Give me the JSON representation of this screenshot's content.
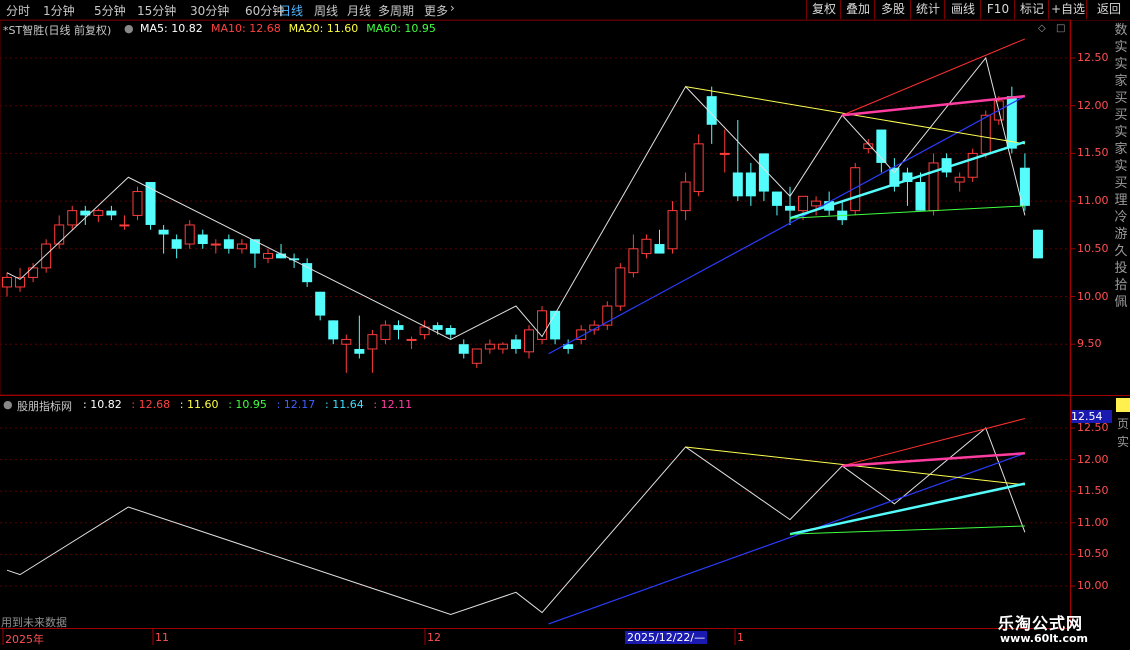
{
  "periods": [
    "分时",
    "1分钟",
    "5分钟",
    "15分钟",
    "30分钟",
    "60分钟",
    "日线",
    "周线",
    "月线",
    "多周期",
    "更多"
  ],
  "active_period": "日线",
  "right_buttons": [
    "复权",
    "叠加",
    "多股",
    "统计",
    "画线",
    "F10",
    "标记",
    "+自选",
    "返回"
  ],
  "main": {
    "title": "*ST智胜(日线 前复权)",
    "ma": [
      {
        "label": "MA5: 10.82",
        "color": "#ffffff"
      },
      {
        "label": "MA10: 12.68",
        "color": "#ff4040"
      },
      {
        "label": "MA20: 11.60",
        "color": "#ffff40"
      },
      {
        "label": "MA60: 10.95",
        "color": "#40ff40"
      }
    ],
    "yticks": [
      "12.50",
      "12.00",
      "11.50",
      "11.00",
      "10.50",
      "10.00",
      "9.50"
    ]
  },
  "sub": {
    "title": "股朋指标网",
    "values": [
      {
        "label": ": 10.82",
        "color": "#ffffff"
      },
      {
        "label": ": 12.68",
        "color": "#ff4040"
      },
      {
        "label": ": 11.60",
        "color": "#ffff40"
      },
      {
        "label": ": 10.95",
        "color": "#40ff40"
      },
      {
        "label": ": 12.17",
        "color": "#4060ff"
      },
      {
        "label": ": 11.64",
        "color": "#40e0ff"
      },
      {
        "label": ": 12.11",
        "color": "#ff40a0"
      }
    ],
    "yticks": [
      "12.50",
      "12.00",
      "11.50",
      "11.00",
      "10.50",
      "10.00"
    ],
    "current_value": "12.54",
    "future_note": "用到未来数据"
  },
  "time_axis": {
    "labels": [
      "2025年",
      "11",
      "12",
      "1"
    ],
    "cursor_date": "2025/12/22/—"
  },
  "side_text": [
    "数",
    "实",
    "实",
    "家",
    "买",
    "买",
    "实",
    "家",
    "实",
    "买",
    "理",
    "冷",
    "游",
    "久",
    "投",
    "拾",
    "佩"
  ],
  "sub_side_text": [
    "页",
    "实"
  ],
  "watermark": {
    "name": "乐淘公式网",
    "url": "www.60lt.com"
  },
  "chart_data": {
    "type": "candlestick",
    "price_range": [
      9.0,
      12.9
    ],
    "candles": [
      {
        "o": 10.1,
        "h": 10.25,
        "l": 10.0,
        "c": 10.2
      },
      {
        "o": 10.1,
        "h": 10.3,
        "l": 10.05,
        "c": 10.2
      },
      {
        "o": 10.2,
        "h": 10.35,
        "l": 10.15,
        "c": 10.3
      },
      {
        "o": 10.3,
        "h": 10.6,
        "l": 10.25,
        "c": 10.55
      },
      {
        "o": 10.55,
        "h": 10.85,
        "l": 10.5,
        "c": 10.75
      },
      {
        "o": 10.75,
        "h": 10.95,
        "l": 10.7,
        "c": 10.9
      },
      {
        "o": 10.9,
        "h": 10.95,
        "l": 10.75,
        "c": 10.85
      },
      {
        "o": 10.85,
        "h": 10.92,
        "l": 10.78,
        "c": 10.9
      },
      {
        "o": 10.9,
        "h": 10.95,
        "l": 10.8,
        "c": 10.85
      },
      {
        "o": 10.75,
        "h": 10.85,
        "l": 10.7,
        "c": 10.75
      },
      {
        "o": 10.85,
        "h": 11.15,
        "l": 10.8,
        "c": 11.1
      },
      {
        "o": 11.2,
        "h": 11.2,
        "l": 10.7,
        "c": 10.75
      },
      {
        "o": 10.7,
        "h": 10.75,
        "l": 10.45,
        "c": 10.65
      },
      {
        "o": 10.6,
        "h": 10.65,
        "l": 10.4,
        "c": 10.5
      },
      {
        "o": 10.55,
        "h": 10.8,
        "l": 10.5,
        "c": 10.75
      },
      {
        "o": 10.65,
        "h": 10.7,
        "l": 10.5,
        "c": 10.55
      },
      {
        "o": 10.55,
        "h": 10.6,
        "l": 10.45,
        "c": 10.55
      },
      {
        "o": 10.6,
        "h": 10.65,
        "l": 10.45,
        "c": 10.5
      },
      {
        "o": 10.5,
        "h": 10.6,
        "l": 10.45,
        "c": 10.55
      },
      {
        "o": 10.6,
        "h": 10.6,
        "l": 10.3,
        "c": 10.45
      },
      {
        "o": 10.4,
        "h": 10.5,
        "l": 10.35,
        "c": 10.45
      },
      {
        "o": 10.45,
        "h": 10.55,
        "l": 10.4,
        "c": 10.4
      },
      {
        "o": 10.4,
        "h": 10.45,
        "l": 10.3,
        "c": 10.38
      },
      {
        "o": 10.35,
        "h": 10.4,
        "l": 10.1,
        "c": 10.15
      },
      {
        "o": 10.05,
        "h": 10.05,
        "l": 9.75,
        "c": 9.8
      },
      {
        "o": 9.75,
        "h": 9.75,
        "l": 9.5,
        "c": 9.55
      },
      {
        "o": 9.5,
        "h": 9.6,
        "l": 9.2,
        "c": 9.55
      },
      {
        "o": 9.45,
        "h": 9.8,
        "l": 9.35,
        "c": 9.4
      },
      {
        "o": 9.45,
        "h": 9.65,
        "l": 9.2,
        "c": 9.6
      },
      {
        "o": 9.55,
        "h": 9.75,
        "l": 9.5,
        "c": 9.7
      },
      {
        "o": 9.7,
        "h": 9.75,
        "l": 9.55,
        "c": 9.65
      },
      {
        "o": 9.55,
        "h": 9.58,
        "l": 9.45,
        "c": 9.55
      },
      {
        "o": 9.6,
        "h": 9.75,
        "l": 9.55,
        "c": 9.68
      },
      {
        "o": 9.7,
        "h": 9.73,
        "l": 9.6,
        "c": 9.65
      },
      {
        "o": 9.67,
        "h": 9.7,
        "l": 9.55,
        "c": 9.6
      },
      {
        "o": 9.5,
        "h": 9.55,
        "l": 9.35,
        "c": 9.4
      },
      {
        "o": 9.3,
        "h": 9.45,
        "l": 9.25,
        "c": 9.45
      },
      {
        "o": 9.45,
        "h": 9.55,
        "l": 9.4,
        "c": 9.5
      },
      {
        "o": 9.45,
        "h": 9.52,
        "l": 9.4,
        "c": 9.5
      },
      {
        "o": 9.55,
        "h": 9.6,
        "l": 9.4,
        "c": 9.45
      },
      {
        "o": 9.42,
        "h": 9.7,
        "l": 9.35,
        "c": 9.65
      },
      {
        "o": 9.55,
        "h": 9.9,
        "l": 9.5,
        "c": 9.85
      },
      {
        "o": 9.85,
        "h": 9.85,
        "l": 9.5,
        "c": 9.55
      },
      {
        "o": 9.5,
        "h": 9.55,
        "l": 9.4,
        "c": 9.45
      },
      {
        "o": 9.55,
        "h": 9.7,
        "l": 9.5,
        "c": 9.65
      },
      {
        "o": 9.65,
        "h": 9.75,
        "l": 9.6,
        "c": 9.7
      },
      {
        "o": 9.7,
        "h": 9.95,
        "l": 9.65,
        "c": 9.9
      },
      {
        "o": 9.9,
        "h": 10.35,
        "l": 9.85,
        "c": 10.3
      },
      {
        "o": 10.25,
        "h": 10.65,
        "l": 10.2,
        "c": 10.5
      },
      {
        "o": 10.45,
        "h": 10.65,
        "l": 10.4,
        "c": 10.6
      },
      {
        "o": 10.55,
        "h": 10.7,
        "l": 10.5,
        "c": 10.45
      },
      {
        "o": 10.5,
        "h": 11.0,
        "l": 10.45,
        "c": 10.9
      },
      {
        "o": 10.9,
        "h": 11.3,
        "l": 10.8,
        "c": 11.2
      },
      {
        "o": 11.1,
        "h": 11.7,
        "l": 11.05,
        "c": 11.6
      },
      {
        "o": 12.1,
        "h": 12.2,
        "l": 11.6,
        "c": 11.8
      },
      {
        "o": 11.5,
        "h": 11.75,
        "l": 11.3,
        "c": 11.5
      },
      {
        "o": 11.3,
        "h": 11.85,
        "l": 11.0,
        "c": 11.05
      },
      {
        "o": 11.3,
        "h": 11.4,
        "l": 10.95,
        "c": 11.05
      },
      {
        "o": 11.5,
        "h": 11.5,
        "l": 11.0,
        "c": 11.1
      },
      {
        "o": 11.1,
        "h": 11.1,
        "l": 10.85,
        "c": 10.95
      },
      {
        "o": 10.95,
        "h": 11.15,
        "l": 10.75,
        "c": 10.9
      },
      {
        "o": 10.9,
        "h": 11.05,
        "l": 10.8,
        "c": 11.05
      },
      {
        "o": 10.95,
        "h": 11.05,
        "l": 10.85,
        "c": 11.0
      },
      {
        "o": 11.0,
        "h": 11.1,
        "l": 10.85,
        "c": 10.9
      },
      {
        "o": 10.9,
        "h": 11.0,
        "l": 10.75,
        "c": 10.8
      },
      {
        "o": 10.9,
        "h": 11.4,
        "l": 10.85,
        "c": 11.35
      },
      {
        "o": 11.55,
        "h": 11.65,
        "l": 11.5,
        "c": 11.6
      },
      {
        "o": 11.75,
        "h": 11.75,
        "l": 11.3,
        "c": 11.4
      },
      {
        "o": 11.35,
        "h": 11.45,
        "l": 11.1,
        "c": 11.15
      },
      {
        "o": 11.3,
        "h": 11.35,
        "l": 10.95,
        "c": 11.2
      },
      {
        "o": 11.2,
        "h": 11.3,
        "l": 10.9,
        "c": 10.9
      },
      {
        "o": 10.9,
        "h": 11.5,
        "l": 10.85,
        "c": 11.4
      },
      {
        "o": 11.45,
        "h": 11.5,
        "l": 11.25,
        "c": 11.3
      },
      {
        "o": 11.2,
        "h": 11.3,
        "l": 11.1,
        "c": 11.25
      },
      {
        "o": 11.25,
        "h": 11.55,
        "l": 11.2,
        "c": 11.5
      },
      {
        "o": 11.5,
        "h": 11.95,
        "l": 11.45,
        "c": 11.9
      },
      {
        "o": 11.85,
        "h": 12.1,
        "l": 11.8,
        "c": 12.05
      },
      {
        "o": 12.1,
        "h": 12.2,
        "l": 11.5,
        "c": 11.55
      },
      {
        "o": 11.35,
        "h": 11.5,
        "l": 10.9,
        "c": 10.95
      },
      {
        "o": 10.7,
        "h": 10.7,
        "l": 10.4,
        "c": 10.4
      }
    ]
  }
}
